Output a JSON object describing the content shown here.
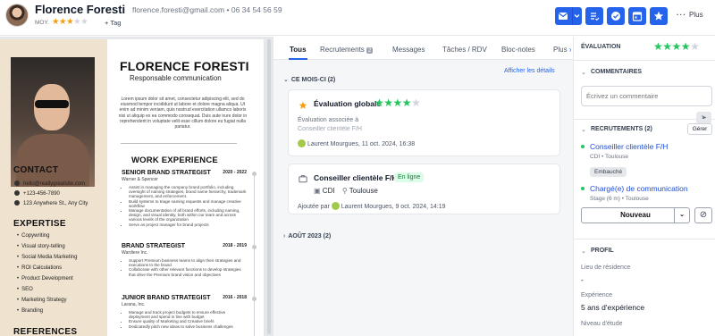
{
  "header": {
    "name": "Florence Foresti",
    "email": "florence.foresti@gmail.com",
    "phone_sep": "•",
    "phone": "06 34 54 56 59",
    "avg_label": "MOY.",
    "avg_rating": 3,
    "avg_max": 5,
    "tag_label": "+ Tag",
    "more_label": "Plus"
  },
  "cv": {
    "name": "FLORENCE FORESTI",
    "role": "Responsable communication",
    "about": "Lorem ipsum dolor sit amet, consectetur adipiscing elit, sed do eiusmod tempor incididunt ut labore et dolore magna aliqua. Ut enim ad minim veniam, quis nostrud exercitation ullamco laboris nisi ut aliquip ex ea commodo consequat. Duis aute irure dolor in reprehenderit in voluptate velit esse cillum dolore eu fugiat nulla pariatur.",
    "contact_title": "CONTACT",
    "contact": [
      "hello@reallygreatsite.com",
      "+123-456-7890",
      "123 Anywhere St., Any City"
    ],
    "expertise_title": "EXPERTISE",
    "expertise": [
      "Copywriting",
      "Visual story-telling",
      "Social Media Marketing",
      "ROI Calculations",
      "Product Development",
      "SEO",
      "Marketing Strategy",
      "Branding"
    ],
    "references_title": "REFERENCES",
    "work_title": "WORK EXPERIENCE",
    "jobs": [
      {
        "title": "SENIOR BRAND STRATEGIST",
        "dates": "2020 - 2022",
        "company": "Warner & Spencer",
        "bullets": [
          "Assist in managing the company brand portfolio, including oversight of naming strategies, brand name hierarchy, trademark management, and enforcement.",
          "Build systems to triage naming requests and manage creative workflow",
          "Manage documentation of all brand efforts, including naming, design, and visual identity, both within our team and across various levels of the organization",
          "Serve as project manager for brand projects"
        ]
      },
      {
        "title": "BRAND STRATEGIST",
        "dates": "2018 - 2019",
        "company": "Wardiere Inc.",
        "bullets": [
          "Support Premium business teams to align their strategies and executions to the brand",
          "Collaborate with other relevant functions to develop strategies that drive the Premium brand vision and objectives"
        ]
      },
      {
        "title": "JUNIOR BRAND STRATEGIST",
        "dates": "2016 - 2018",
        "company": "Larana, Inc.",
        "bullets": [
          "Manage and track project budgets to ensure effective deployment and spend in line with budget",
          "Ensure quality of Marketing and Creative briefs",
          "Dedicatedly pitch new ideas to solve business challenges"
        ]
      }
    ]
  },
  "tabs": [
    {
      "label": "Tous"
    },
    {
      "label": "Recrutements",
      "badge": "2"
    },
    {
      "label": "Messages"
    },
    {
      "label": "Tâches / RDV"
    },
    {
      "label": "Bloc-notes"
    },
    {
      "label": "Plus"
    }
  ],
  "feed": {
    "show_details": "Afficher les détails",
    "section_current": "CE MOIS-CI (2)",
    "section_past": "AOÛT 2023 (2)",
    "eval_card": {
      "title": "Évaluation globale",
      "rating": 4,
      "max": 5,
      "sub1": "Évaluation associée à",
      "sub2": "Conseiller clientèle F/H",
      "author_line": "Laurent Mourgues, 11 oct. 2024, 16:38"
    },
    "job_card": {
      "title": "Conseiller clientèle F/H",
      "status": "En ligne",
      "contract": "CDI",
      "location": "Toulouse",
      "added_prefix": "Ajoutée par",
      "author_line": "Laurent Mourgues, 9 oct. 2024, 14:19"
    }
  },
  "right": {
    "eval_label": "ÉVALUATION",
    "eval_rating": 4,
    "eval_max": 5,
    "comments_label": "COMMENTAIRES",
    "comment_placeholder": "Écrivez un commentaire",
    "recruit_label": "RECRUTEMENTS (2)",
    "manage_label": "Gérer",
    "recruitments": [
      {
        "title": "Conseiller clientèle F/H",
        "sub": "CDI • Toulouse",
        "badge": "Embauché"
      },
      {
        "title": "Chargé(e) de communication",
        "sub": "Stage (6 m) • Toulouse"
      }
    ],
    "stage_select": "Nouveau",
    "profile_label": "PROFIL",
    "profile": [
      {
        "key": "Lieu de résidence",
        "value": "-"
      },
      {
        "key": "Expérience",
        "value": "5 ans d'expérience"
      },
      {
        "key": "Niveau d'étude",
        "value": ""
      }
    ]
  },
  "colors": {
    "accent": "#2563eb",
    "star_yellow": "#f59e0b",
    "star_green": "#22c55e",
    "online_bg": "#dcfce7",
    "cv_sidebar": "#efe2cf"
  },
  "icons": [
    "mail-icon",
    "chevron-down-icon",
    "checklist-icon",
    "check-circle-icon",
    "calendar-icon",
    "star-icon",
    "more-dots-icon",
    "star-badge-icon",
    "briefcase-icon",
    "location-pin-icon",
    "send-icon",
    "block-icon"
  ]
}
